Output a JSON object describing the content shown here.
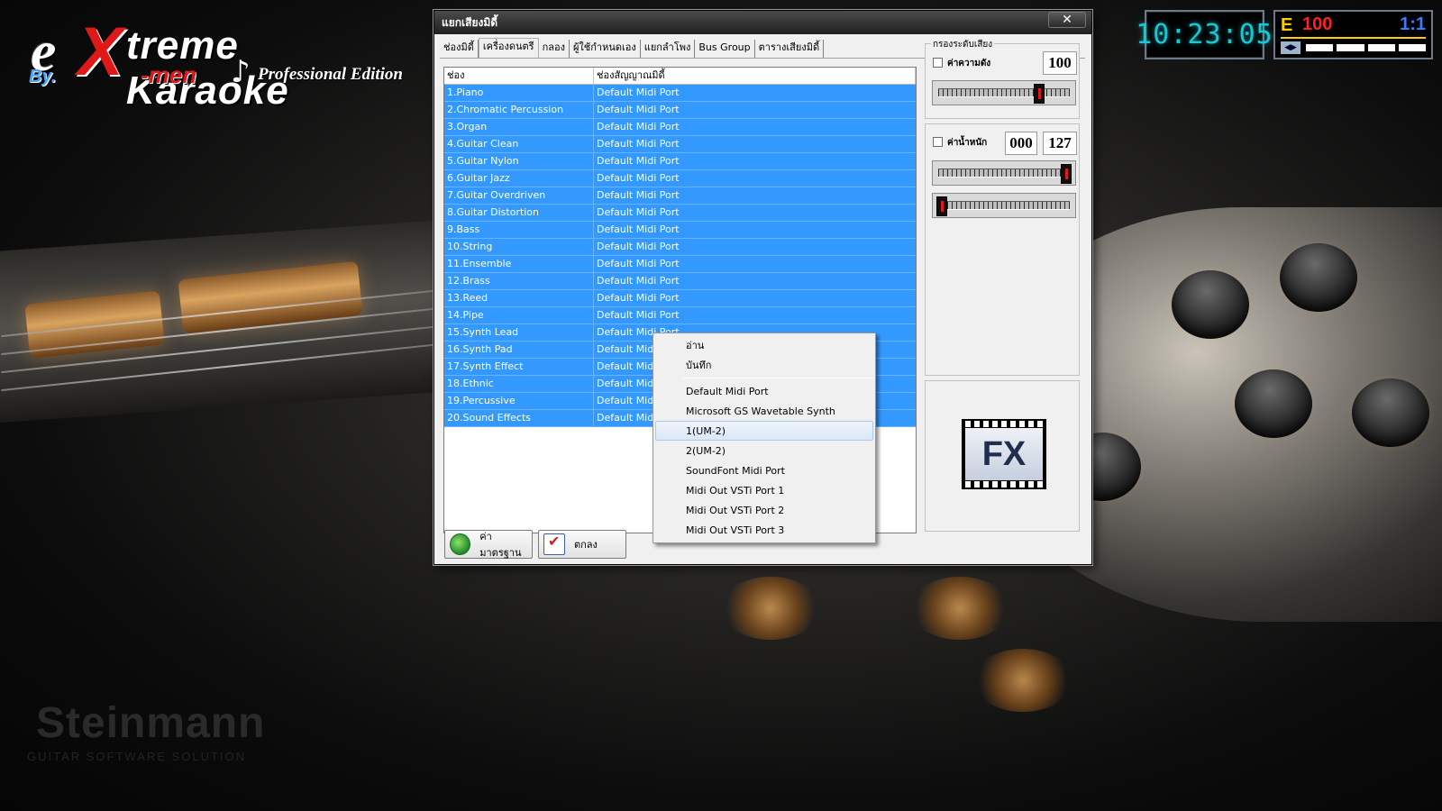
{
  "logo": {
    "e": "e",
    "x": "X",
    "treme": "treme Karaoke",
    "by": "By.",
    "xmen": "-men",
    "note": "♪",
    "edition": "Professional Edition"
  },
  "clock": {
    "time": "10:23:05"
  },
  "status": {
    "mode": "E",
    "volume": "100",
    "ratio": "1:1",
    "icon": "◀▶",
    "levels": [
      0.2,
      0.2,
      0.2,
      0.2
    ]
  },
  "background": {
    "watermark_big": "Steinmann",
    "watermark_small": "GUITAR SOFTWARE SOLUTION"
  },
  "dialog": {
    "title": "แยกเสียงมิดี้",
    "close_label": "✕",
    "tabs": [
      {
        "label": "ช่องมิดี้"
      },
      {
        "label": "เครื่องดนตรี"
      },
      {
        "label": "กลอง"
      },
      {
        "label": "ผู้ใช้กำหนดเอง"
      },
      {
        "label": "แยกลำโพง"
      },
      {
        "label": "Bus Group"
      },
      {
        "label": "ตารางเสียงมิดี้"
      }
    ],
    "active_tab": 1,
    "list": {
      "headers": [
        "ช่อง",
        "ช่องสัญญาณมิดี้"
      ],
      "rows": [
        [
          "1.Piano",
          "Default Midi Port"
        ],
        [
          "2.Chromatic Percussion",
          "Default Midi Port"
        ],
        [
          "3.Organ",
          "Default Midi Port"
        ],
        [
          "4.Guitar Clean",
          "Default Midi Port"
        ],
        [
          "5.Guitar Nylon",
          "Default Midi Port"
        ],
        [
          "6.Guitar Jazz",
          "Default Midi Port"
        ],
        [
          "7.Guitar Overdriven",
          "Default Midi Port"
        ],
        [
          "8.Guitar Distortion",
          "Default Midi Port"
        ],
        [
          "9.Bass",
          "Default Midi Port"
        ],
        [
          "10.String",
          "Default Midi Port"
        ],
        [
          "11.Ensemble",
          "Default Midi Port"
        ],
        [
          "12.Brass",
          "Default Midi Port"
        ],
        [
          "13.Reed",
          "Default Midi Port"
        ],
        [
          "14.Pipe",
          "Default Midi Port"
        ],
        [
          "15.Synth Lead",
          "Default Midi Port"
        ],
        [
          "16.Synth Pad",
          "Default Midi Port"
        ],
        [
          "17.Synth Effect",
          "Default Midi Port"
        ],
        [
          "18.Ethnic",
          "Default Midi Port"
        ],
        [
          "19.Percussive",
          "Default Midi Port"
        ],
        [
          "20.Sound Effects",
          "Default Midi Port"
        ]
      ]
    },
    "buttons": {
      "default_label": "ค่ามาตรฐาน",
      "ok_label": "ตกลง"
    },
    "filter": {
      "title": "กรองระดับเสียง",
      "checkbox_label": "ค่าความดัง",
      "value": "100",
      "slider_level": 0.78
    },
    "weight": {
      "checkbox_label": "ค่าน้ำหนัก",
      "min_value": "000",
      "max_value": "127",
      "slider_max_level": 1.0,
      "slider_min_level": 0.0
    },
    "fx": {
      "label": "FX"
    }
  },
  "context_menu": {
    "top_items": [
      "อ่าน",
      "บันทึก"
    ],
    "port_items": [
      "Default Midi Port",
      "Microsoft GS Wavetable Synth",
      "1(UM-2)",
      "2(UM-2)",
      "SoundFont Midi Port",
      "Midi Out VSTi Port 1",
      "Midi Out VSTi Port 2",
      "Midi Out VSTi Port 3"
    ],
    "highlighted_index": 2
  },
  "colors": {
    "selection": "#3399ff",
    "clock_digits": "#19c7d4",
    "volume": "#ff2020",
    "ratio": "#3a7bff",
    "mode": "#ffcc00",
    "logo_red": "#e01818"
  }
}
